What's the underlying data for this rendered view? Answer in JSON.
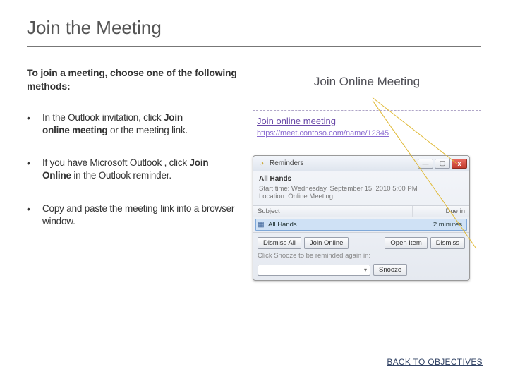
{
  "title": "Join the Meeting",
  "intro": "To join a meeting, choose one of the following methods:",
  "bullets": {
    "b1a": "In the Outlook invitation, click ",
    "b1b": "Join",
    "b1c": "online meeting",
    "b1d": " or the meeting link.",
    "b2a": "If you have Microsoft Outlook , click ",
    "b2b": "Join Online",
    "b2c": " in the Outlook reminder.",
    "b3": "Copy and paste the meeting link into a browser window."
  },
  "right_heading": "Join Online Meeting",
  "invite": {
    "title": "Join online meeting",
    "url": "https://meet.contoso.com/name/12345"
  },
  "reminder": {
    "window_title": "Reminders",
    "close": "x",
    "subject_line": "All Hands",
    "start_time": "Start time: Wednesday, September 15, 2010 5:00 PM",
    "location": "Location: Online Meeting",
    "col_subject": "Subject",
    "col_due": "Due in",
    "row_subject": "All Hands",
    "row_due": "2 minutes",
    "btn_dismiss_all": "Dismiss All",
    "btn_join_online": "Join Online",
    "btn_open_item": "Open Item",
    "btn_dismiss": "Dismiss",
    "snooze_label": "Click Snooze to be reminded again in:",
    "snooze_value": "",
    "btn_snooze": "Snooze"
  },
  "back_link": "BACK TO OBJECTIVES"
}
